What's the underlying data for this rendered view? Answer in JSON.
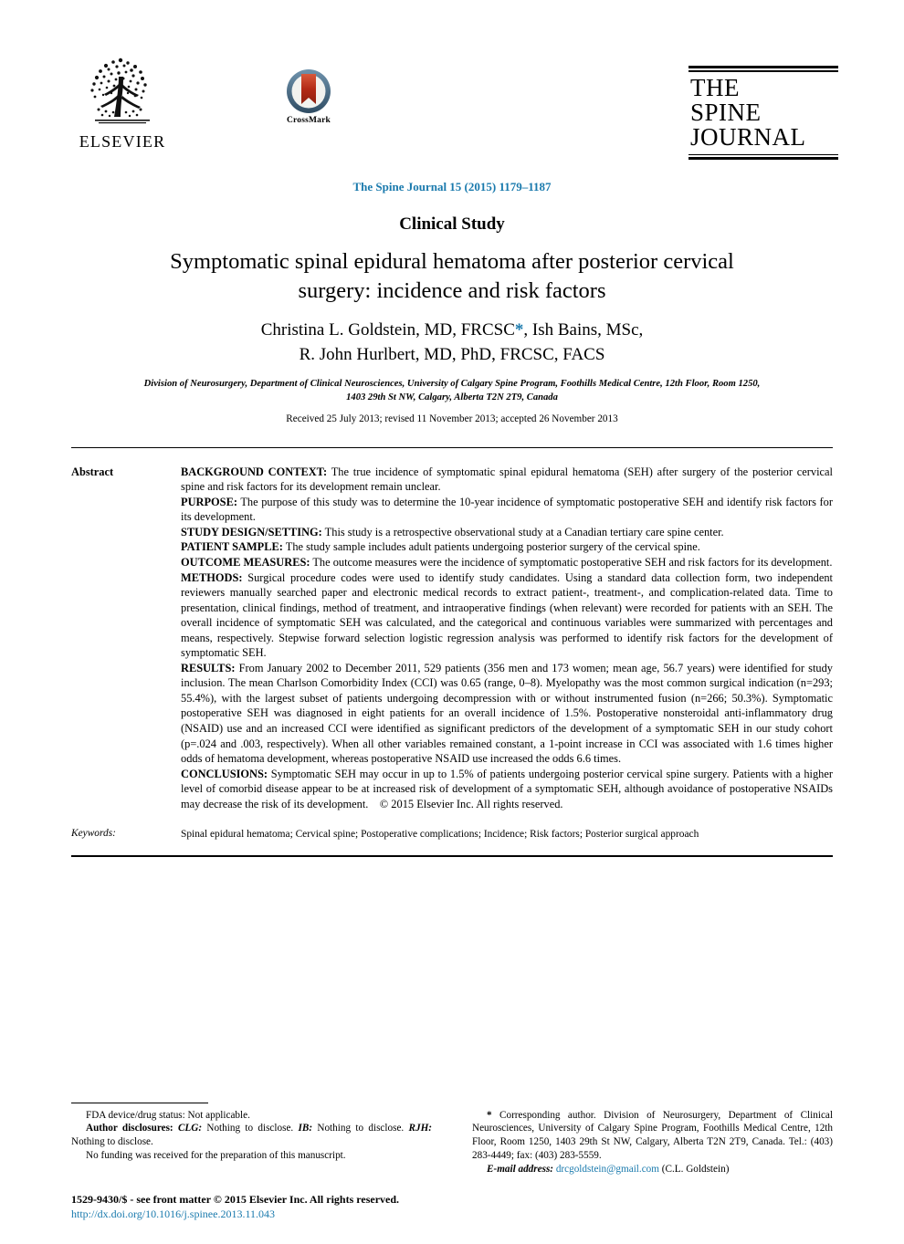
{
  "publisher": {
    "elsevier_name": "ELSEVIER",
    "crossmark_label": "CrossMark",
    "journal_logo_line1": "THE",
    "journal_logo_line2": "SPINE",
    "journal_logo_line3": "JOURNAL"
  },
  "header": {
    "citation": "The Spine Journal 15 (2015) 1179–1187",
    "section": "Clinical Study"
  },
  "article": {
    "title": "Symptomatic spinal epidural hematoma after posterior cervical surgery: incidence and risk factors",
    "authors_line1_pre": "Christina L. Goldstein, MD, FRCSC",
    "authors_corresponding_marker": "*",
    "authors_line1_post": ", Ish Bains, MSc,",
    "authors_line2": "R. John Hurlbert, MD, PhD, FRCSC, FACS",
    "affiliation_line1": "Division of Neurosurgery, Department of Clinical Neurosciences, University of Calgary Spine Program, Foothills Medical Centre, 12th Floor, Room 1250,",
    "affiliation_line2": "1403 29th St NW, Calgary, Alberta T2N 2T9, Canada",
    "history": "Received 25 July 2013; revised 11 November 2013; accepted 26 November 2013"
  },
  "abstract": {
    "label": "Abstract",
    "sections": [
      {
        "heading": "BACKGROUND CONTEXT:",
        "text": " The true incidence of symptomatic spinal epidural hematoma (SEH) after surgery of the posterior cervical spine and risk factors for its development remain unclear."
      },
      {
        "heading": "PURPOSE:",
        "text": " The purpose of this study was to determine the 10-year incidence of symptomatic postoperative SEH and identify risk factors for its development."
      },
      {
        "heading": "STUDY DESIGN/SETTING:",
        "text": " This study is a retrospective observational study at a Canadian tertiary care spine center."
      },
      {
        "heading": "PATIENT SAMPLE:",
        "text": " The study sample includes adult patients undergoing posterior surgery of the cervical spine."
      },
      {
        "heading": "OUTCOME MEASURES:",
        "text": " The outcome measures were the incidence of symptomatic postoperative SEH and risk factors for its development."
      },
      {
        "heading": "METHODS:",
        "text": " Surgical procedure codes were used to identify study candidates. Using a standard data collection form, two independent reviewers manually searched paper and electronic medical records to extract patient-, treatment-, and complication-related data. Time to presentation, clinical findings, method of treatment, and intraoperative findings (when relevant) were recorded for patients with an SEH. The overall incidence of symptomatic SEH was calculated, and the categorical and continuous variables were summarized with percentages and means, respectively. Stepwise forward selection logistic regression analysis was performed to identify risk factors for the development of symptomatic SEH."
      },
      {
        "heading": "RESULTS:",
        "text": " From January 2002 to December 2011, 529 patients (356 men and 173 women; mean age, 56.7 years) were identified for study inclusion. The mean Charlson Comorbidity Index (CCI) was 0.65 (range, 0–8). Myelopathy was the most common surgical indication (n=293; 55.4%), with the largest subset of patients undergoing decompression with or without instrumented fusion (n=266; 50.3%). Symptomatic postoperative SEH was diagnosed in eight patients for an overall incidence of 1.5%. Postoperative nonsteroidal anti-inflammatory drug (NSAID) use and an increased CCI were identified as significant predictors of the development of a symptomatic SEH in our study cohort (p=.024 and .003, respectively). When all other variables remained constant, a 1-point increase in CCI was associated with 1.6 times higher odds of hematoma development, whereas postoperative NSAID use increased the odds 6.6 times."
      },
      {
        "heading": "CONCLUSIONS:",
        "text": " Symptomatic SEH may occur in up to 1.5% of patients undergoing posterior cervical spine surgery. Patients with a higher level of comorbid disease appear to be at increased risk of development of a symptomatic SEH, although avoidance of postoperative NSAIDs may decrease the risk of its development. © 2015 Elsevier Inc. All rights reserved."
      }
    ]
  },
  "keywords": {
    "label": "Keywords:",
    "text": "Spinal epidural hematoma; Cervical spine; Postoperative complications; Incidence; Risk factors; Posterior surgical approach"
  },
  "footnotes": {
    "left": {
      "fda": "FDA device/drug status: Not applicable.",
      "disclosures_lead": "Author disclosures: ",
      "disclosure_1_initials": "CLG:",
      "disclosure_1_text": " Nothing to disclose. ",
      "disclosure_2_initials": "IB:",
      "disclosure_2_text": " Nothing to disclose. ",
      "disclosure_3_initials": "RJH:",
      "disclosure_3_text": " Nothing to disclose.",
      "funding": "No funding was received for the preparation of this manuscript."
    },
    "right": {
      "corresponding_marker": "*",
      "corresponding_text": " Corresponding author. Division of Neurosurgery, Department of Clinical Neurosciences, University of Calgary Spine Program, Foothills Medical Centre, 12th Floor, Room 1250, 1403 29th St NW, Calgary, Alberta T2N 2T9, Canada. Tel.: (403) 283-4449; fax: (403) 283-5559.",
      "email_label": "E-mail address:",
      "email": " drcgoldstein@gmail.com",
      "email_owner": " (C.L. Goldstein)"
    }
  },
  "bottom": {
    "issn_line": "1529-9430/$ - see front matter © 2015 Elsevier Inc. All rights reserved.",
    "doi": "http://dx.doi.org/10.1016/j.spinee.2013.11.043"
  },
  "colors": {
    "link_blue": "#1a7aad",
    "crossmark_ring": "#4a6f8a",
    "crossmark_ribbon": "#b02b18"
  }
}
